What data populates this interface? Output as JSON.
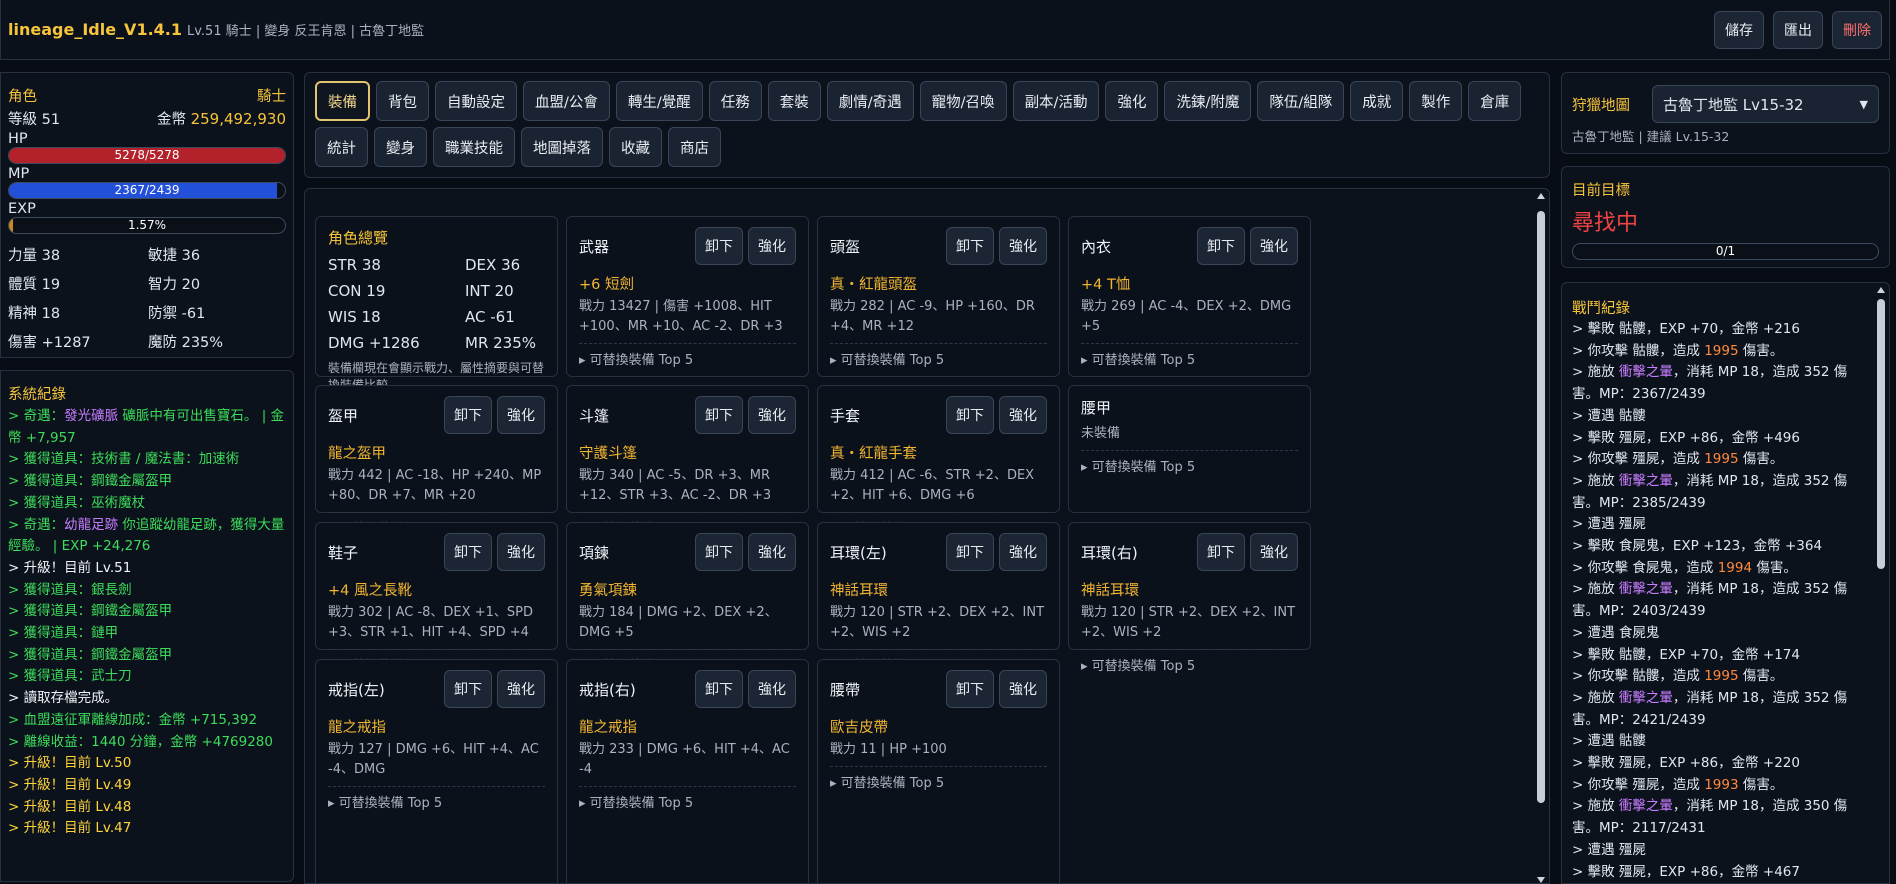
{
  "header": {
    "app_name": "lineage_Idle_V1.4.1",
    "subtitle": "Lv.51 騎士 | 變身 反王肯恩 | 古魯丁地監",
    "save": "儲存",
    "export": "匯出",
    "delete": "刪除"
  },
  "character": {
    "title": "角色",
    "class": "騎士",
    "level_label": "等級 51",
    "gold_label": "金幣",
    "gold": "259,492,930",
    "hp_label": "HP",
    "hp_text": "5278/5278",
    "hp_ratio": 1.0,
    "mp_label": "MP",
    "mp_text": "2367/2439",
    "mp_ratio": 0.9705,
    "exp_label": "EXP",
    "exp_text": "1.57%",
    "exp_ratio": 0.0157,
    "stats": [
      "力量 38",
      "敏捷 36",
      "體質 19",
      "智力 20",
      "精神 18",
      "防禦 -61",
      "傷害 +1287",
      "魔防 235%"
    ]
  },
  "system_log": {
    "title": "系統紀錄",
    "entries": [
      {
        "c": "g",
        "t": "> 奇遇：",
        "hl": "發光礦脈",
        "r": " 礦脈中有可出售寶石。 | 金幣 +7,957"
      },
      {
        "c": "g",
        "t": "> 獲得道具：技術書 / 魔法書：加速術"
      },
      {
        "c": "g",
        "t": "> 獲得道具：鋼鐵金屬盔甲"
      },
      {
        "c": "g",
        "t": "> 獲得道具：巫術魔杖"
      },
      {
        "c": "g",
        "t": "> 奇遇：",
        "hl": "幼龍足跡",
        "r": " 你追蹤幼龍足跡，獲得大量經驗。 | EXP +24,276"
      },
      {
        "c": "w",
        "t": "> 升級！目前 Lv.51"
      },
      {
        "c": "g",
        "t": "> 獲得道具：銀長劍"
      },
      {
        "c": "g",
        "t": "> 獲得道具：鋼鐵金屬盔甲"
      },
      {
        "c": "g",
        "t": "> 獲得道具：鏈甲"
      },
      {
        "c": "g",
        "t": "> 獲得道具：鋼鐵金屬盔甲"
      },
      {
        "c": "g",
        "t": "> 獲得道具：武士刀"
      },
      {
        "c": "w",
        "t": "> 讀取存檔完成。"
      },
      {
        "c": "g",
        "t": "> 血盟遠征軍離線加成：金幣 +715,392"
      },
      {
        "c": "g",
        "t": "> 離線收益：1440 分鐘，金幣 +4769280"
      },
      {
        "c": "y",
        "t": "> 升級！目前 Lv.50"
      },
      {
        "c": "y",
        "t": "> 升級！目前 Lv.49"
      },
      {
        "c": "y",
        "t": "> 升級！目前 Lv.48"
      },
      {
        "c": "y",
        "t": "> 升級！目前 Lv.47"
      }
    ]
  },
  "tabs": [
    "裝備",
    "背包",
    "自動設定",
    "血盟/公會",
    "轉生/覺醒",
    "任務",
    "套裝",
    "劇情/奇遇",
    "寵物/召喚",
    "副本/活動",
    "強化",
    "洗鍊/附魔",
    "隊伍/組隊",
    "成就",
    "製作",
    "倉庫",
    "統計",
    "變身",
    "職業技能",
    "地圖掉落",
    "收藏",
    "商店"
  ],
  "equipment": {
    "title": "裝備",
    "unequip": "卸下",
    "enhance": "強化",
    "more": "▸ 可替換裝備 Top 5",
    "overview": {
      "title": "角色總覽",
      "stats": [
        "STR 38",
        "DEX 36",
        "CON 19",
        "INT 20",
        "WIS 18",
        "AC -61",
        "DMG +1286",
        "MR 235%"
      ],
      "note": "裝備欄現在會顯示戰力、屬性摘要與可替換裝備比較。"
    },
    "slots": [
      {
        "slot": "武器",
        "item": "+6 短劍",
        "stats": "戰力 13427 | 傷害 +1008、HIT +100、MR +10、AC -2、DR +3"
      },
      {
        "slot": "頭盔",
        "item": "真・紅龍頭盔",
        "stats": "戰力 282 | AC -9、HP +160、DR +4、MR +12"
      },
      {
        "slot": "內衣",
        "item": "+4 T恤",
        "stats": "戰力 269 | AC -4、DEX +2、DMG +5"
      },
      {
        "slot": "盔甲",
        "item": "龍之盔甲",
        "stats": "戰力 442 | AC -18、HP +240、MP +80、DR +7、MR +20"
      },
      {
        "slot": "斗篷",
        "item": "守護斗篷",
        "stats": "戰力 340 | AC -5、DR +3、MR +12、STR +3、AC -2、DR +3"
      },
      {
        "slot": "手套",
        "item": "真・紅龍手套",
        "stats": "戰力 412 | AC -6、STR +2、DEX +2、HIT +6、DMG +6"
      },
      {
        "slot": "腰甲",
        "item": "",
        "empty": "未裝備",
        "stats": ""
      },
      {
        "slot": "鞋子",
        "item": "+4 風之長靴",
        "stats": "戰力 302 | AC -8、DEX +1、SPD +3、STR +1、HIT +4、SPD +4"
      },
      {
        "slot": "項鍊",
        "item": "勇氣項鍊",
        "stats": "戰力 184 | DMG +2、DEX +2、DMG +5"
      },
      {
        "slot": "耳環(左)",
        "item": "神話耳環",
        "stats": "戰力 120 | STR +2、DEX +2、INT +2、WIS +2"
      },
      {
        "slot": "耳環(右)",
        "item": "神話耳環",
        "stats": "戰力 120 | STR +2、DEX +2、INT +2、WIS +2"
      },
      {
        "slot": "戒指(左)",
        "item": "龍之戒指",
        "stats": "戰力 127 | DMG +6、HIT +4、AC -4、DMG"
      },
      {
        "slot": "戒指(右)",
        "item": "龍之戒指",
        "stats": "戰力 233 | DMG +6、HIT +4、AC -4"
      },
      {
        "slot": "腰帶",
        "item": "歐吉皮帶",
        "stats": "戰力 11 | HP +100"
      }
    ]
  },
  "hunt": {
    "title": "狩獵地圖",
    "selected": "古魯丁地監 Lv15-32",
    "info": "古魯丁地監 | 建議 Lv.15-32"
  },
  "target": {
    "title": "目前目標",
    "status": "尋找中",
    "progress": "0/1"
  },
  "battle_log": {
    "title": "戰鬥紀錄",
    "entries": [
      [
        {
          "t": "> 擊敗 骷髏，EXP +70，金幣 +216"
        }
      ],
      [
        {
          "t": "> 你攻擊 骷髏，造成 "
        },
        {
          "t": "1995",
          "c": "o"
        },
        {
          "t": " 傷害。"
        }
      ],
      [
        {
          "t": "> 施放 "
        },
        {
          "t": "衝擊之暈",
          "c": "p"
        },
        {
          "t": "，消耗 MP 18，造成 352 傷害。MP：2367/2439"
        }
      ],
      [
        {
          "t": "> 遭遇 骷髏"
        }
      ],
      [
        {
          "t": "> 擊敗 殭屍，EXP +86，金幣 +496"
        }
      ],
      [
        {
          "t": "> 你攻擊 殭屍，造成 "
        },
        {
          "t": "1995",
          "c": "o"
        },
        {
          "t": " 傷害。"
        }
      ],
      [
        {
          "t": "> 施放 "
        },
        {
          "t": "衝擊之暈",
          "c": "p"
        },
        {
          "t": "，消耗 MP 18，造成 352 傷害。MP：2385/2439"
        }
      ],
      [
        {
          "t": "> 遭遇 殭屍"
        }
      ],
      [
        {
          "t": "> 擊敗 食屍鬼，EXP +123，金幣 +364"
        }
      ],
      [
        {
          "t": "> 你攻擊 食屍鬼，造成 "
        },
        {
          "t": "1994",
          "c": "o"
        },
        {
          "t": " 傷害。"
        }
      ],
      [
        {
          "t": "> 施放 "
        },
        {
          "t": "衝擊之暈",
          "c": "p"
        },
        {
          "t": "，消耗 MP 18，造成 352 傷害。MP：2403/2439"
        }
      ],
      [
        {
          "t": "> 遭遇 食屍鬼"
        }
      ],
      [
        {
          "t": "> 擊敗 骷髏，EXP +70，金幣 +174"
        }
      ],
      [
        {
          "t": "> 你攻擊 骷髏，造成 "
        },
        {
          "t": "1995",
          "c": "o"
        },
        {
          "t": " 傷害。"
        }
      ],
      [
        {
          "t": "> 施放 "
        },
        {
          "t": "衝擊之暈",
          "c": "p"
        },
        {
          "t": "，消耗 MP 18，造成 352 傷害。MP：2421/2439"
        }
      ],
      [
        {
          "t": "> 遭遇 骷髏"
        }
      ],
      [
        {
          "t": "> 擊敗 殭屍，EXP +86，金幣 +220"
        }
      ],
      [
        {
          "t": "> 你攻擊 殭屍，造成 "
        },
        {
          "t": "1993",
          "c": "o"
        },
        {
          "t": " 傷害。"
        }
      ],
      [
        {
          "t": "> 施放 "
        },
        {
          "t": "衝擊之暈",
          "c": "p"
        },
        {
          "t": "，消耗 MP 18，造成 350 傷害。MP：2117/2431"
        }
      ],
      [
        {
          "t": "> 遭遇 殭屍"
        }
      ],
      [
        {
          "t": "> 擊敗 殭屍，EXP +86，金幣 +467"
        }
      ]
    ]
  },
  "colors": {
    "gold": "#f6c43a",
    "hp": "#b3222a",
    "mp": "#2350d8",
    "exp": "#c68a1e",
    "target": "#ef4444"
  }
}
